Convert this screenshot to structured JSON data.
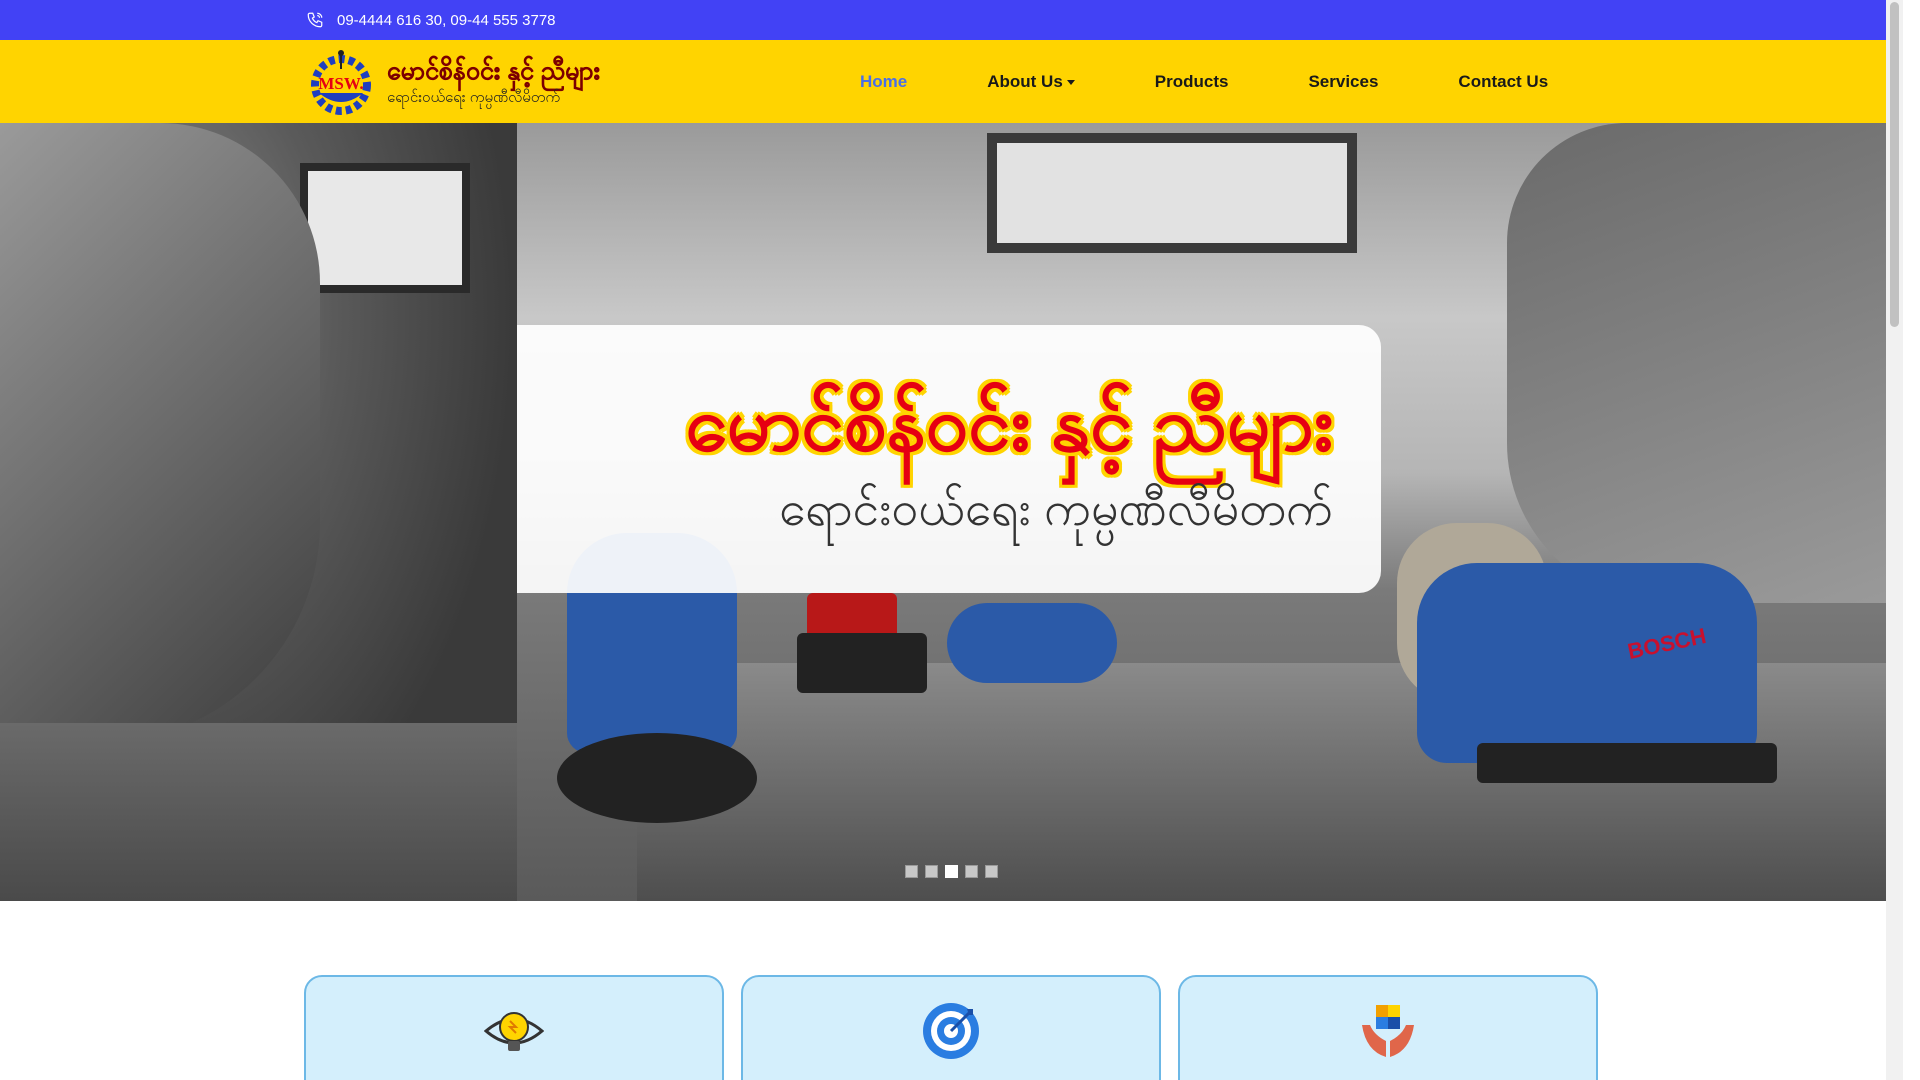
{
  "topbar": {
    "phone_icon": "phone-icon",
    "phones": "09-4444 616 30, 09-44 555 3778"
  },
  "header": {
    "logo_mark": "MSW.",
    "logo_title": "မောင်စိန်ဝင်း နှင့် ညီများ",
    "logo_subtitle": "ရောင်းဝယ်ရေး ကုမ္ပဏီလီမိတက်"
  },
  "nav": {
    "items": [
      "Home",
      "About Us",
      "Products",
      "Services",
      "Contact Us"
    ],
    "active": "Home"
  },
  "hero": {
    "banner_title": "မောင်စိန်ဝင်း နှင့် ညီများ",
    "banner_subtitle": "ရောင်းဝယ်ရေး ကုမ္ပဏီလီမိတက်",
    "brand_on_tool": "BOSCH",
    "slides_count": 5,
    "active_slide": 3
  },
  "cards": [
    {
      "icon": "lightbulb-eye-icon"
    },
    {
      "icon": "target-icon"
    },
    {
      "icon": "hands-puzzle-icon"
    }
  ],
  "colors": {
    "topbar": "#4242f5",
    "header": "#ffd400",
    "brand_red": "#e60012",
    "nav_active": "#4a6fe8",
    "card_bg": "#d4effc",
    "card_border": "#6cb8e6"
  }
}
